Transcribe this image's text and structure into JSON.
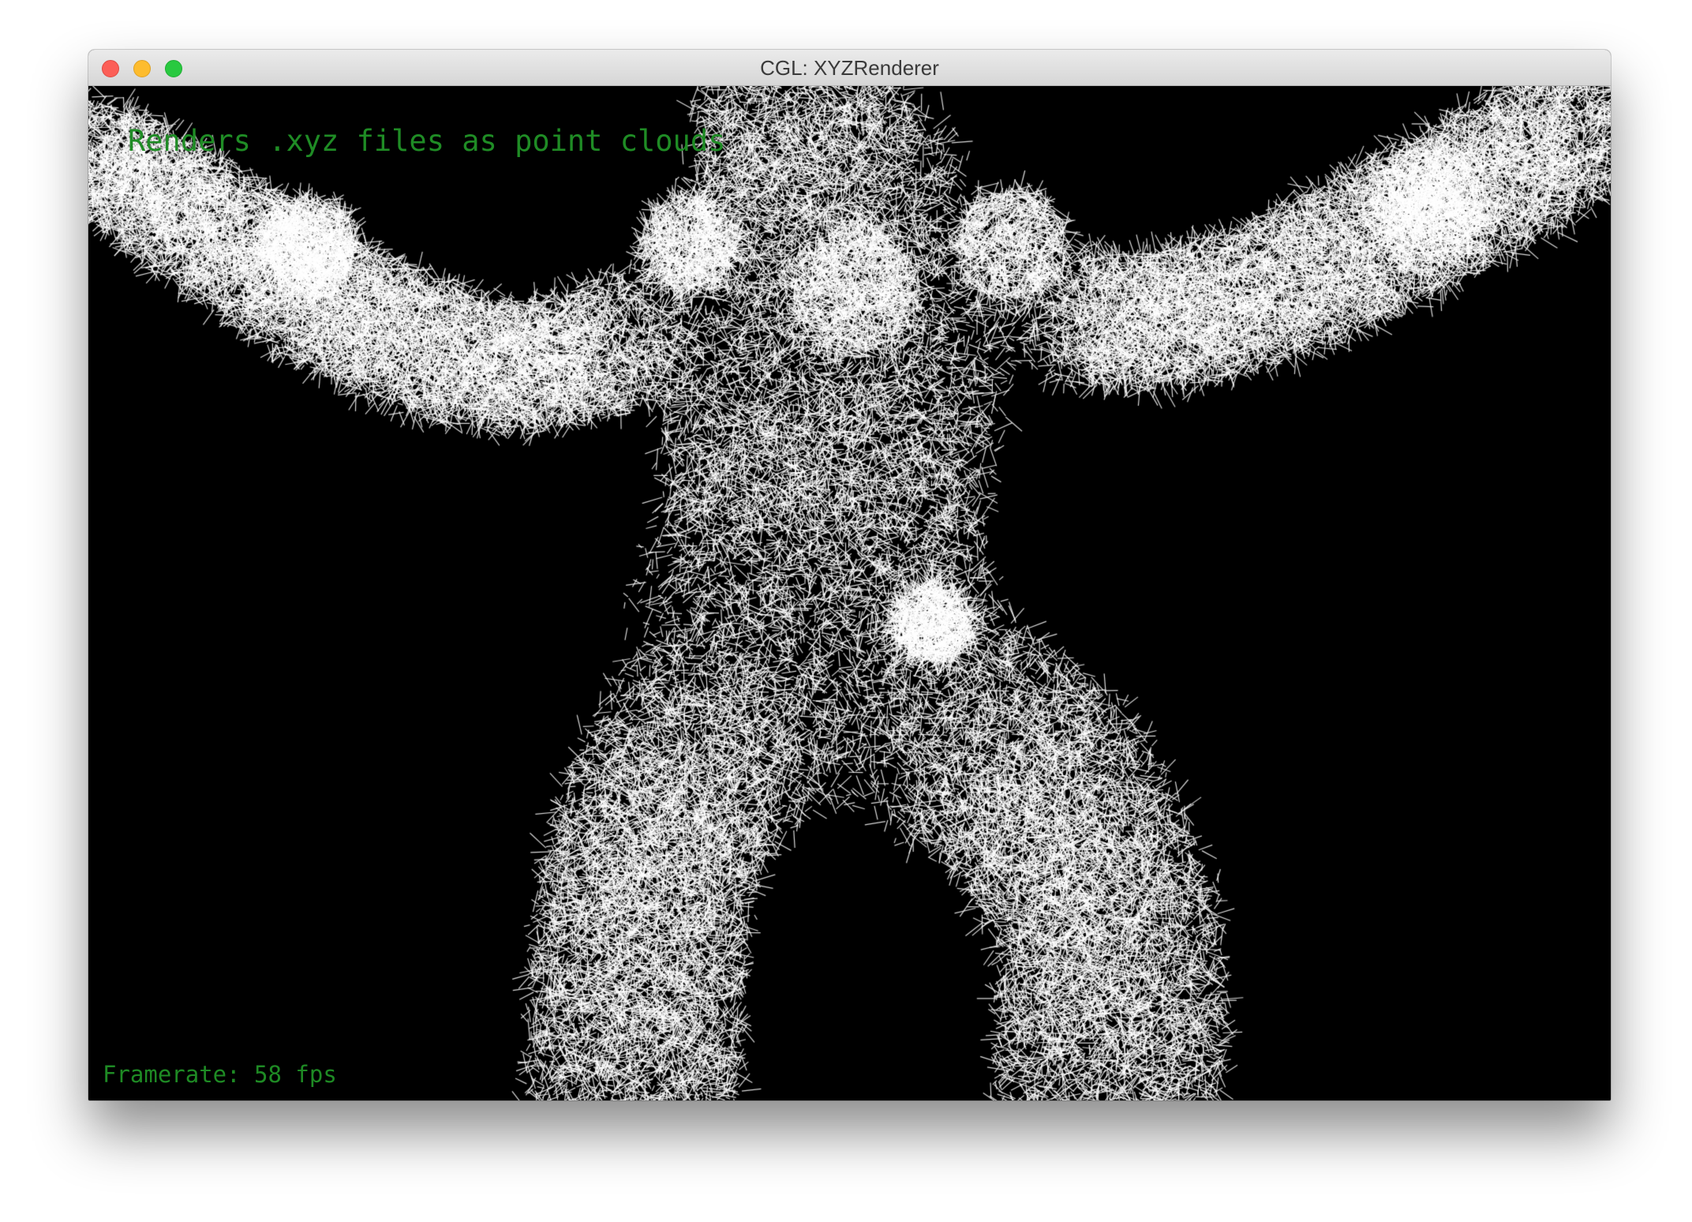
{
  "window": {
    "title": "CGL: XYZRenderer"
  },
  "overlay": {
    "description": "Renders .xyz files as point clouds",
    "framerate_label": "Framerate: 58 fps"
  },
  "render": {
    "background_color": "#000000",
    "point_color": "#ffffff",
    "text_color": "#1e8a24"
  }
}
